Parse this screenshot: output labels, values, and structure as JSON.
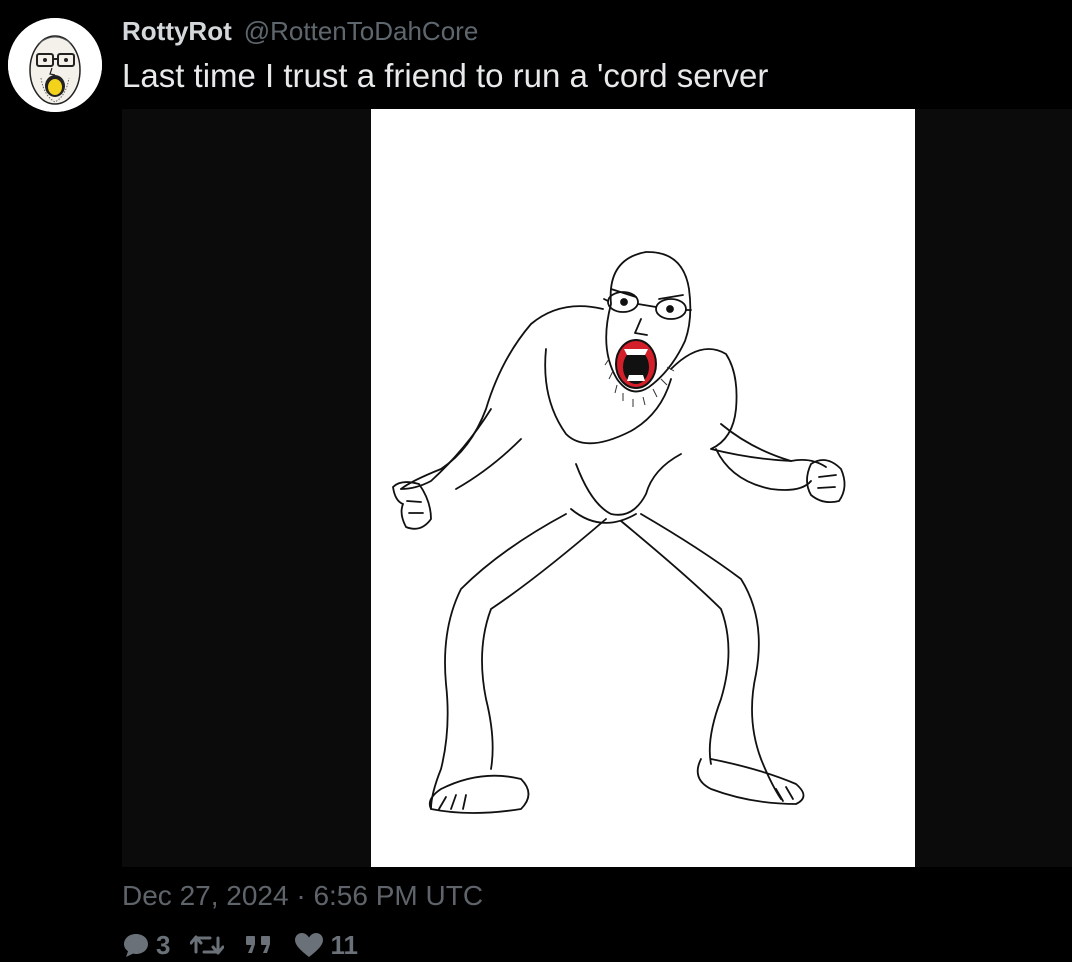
{
  "author": {
    "display_name": "RottyRot",
    "handle": "@RottenToDahCore",
    "avatar_icon": "wojak-avatar"
  },
  "tweet": {
    "text": "Last time I trust a friend to run a 'cord server",
    "timestamp": "Dec 27, 2024 · 6:56 PM UTC"
  },
  "media": {
    "kind": "image",
    "subject_icon": "angry-wojak-drawing"
  },
  "stats": {
    "replies_icon": "comment-icon",
    "replies": "3",
    "retweets_icon": "retweet-icon",
    "quotes_icon": "quote-icon",
    "likes_icon": "heart-icon",
    "likes": "11"
  },
  "colors": {
    "background": "#000000",
    "text_primary": "#e7e9ea",
    "text_secondary": "#5e646a",
    "media_letterbox": "#0b0b0b",
    "mouth_red": "#d21f2a"
  }
}
